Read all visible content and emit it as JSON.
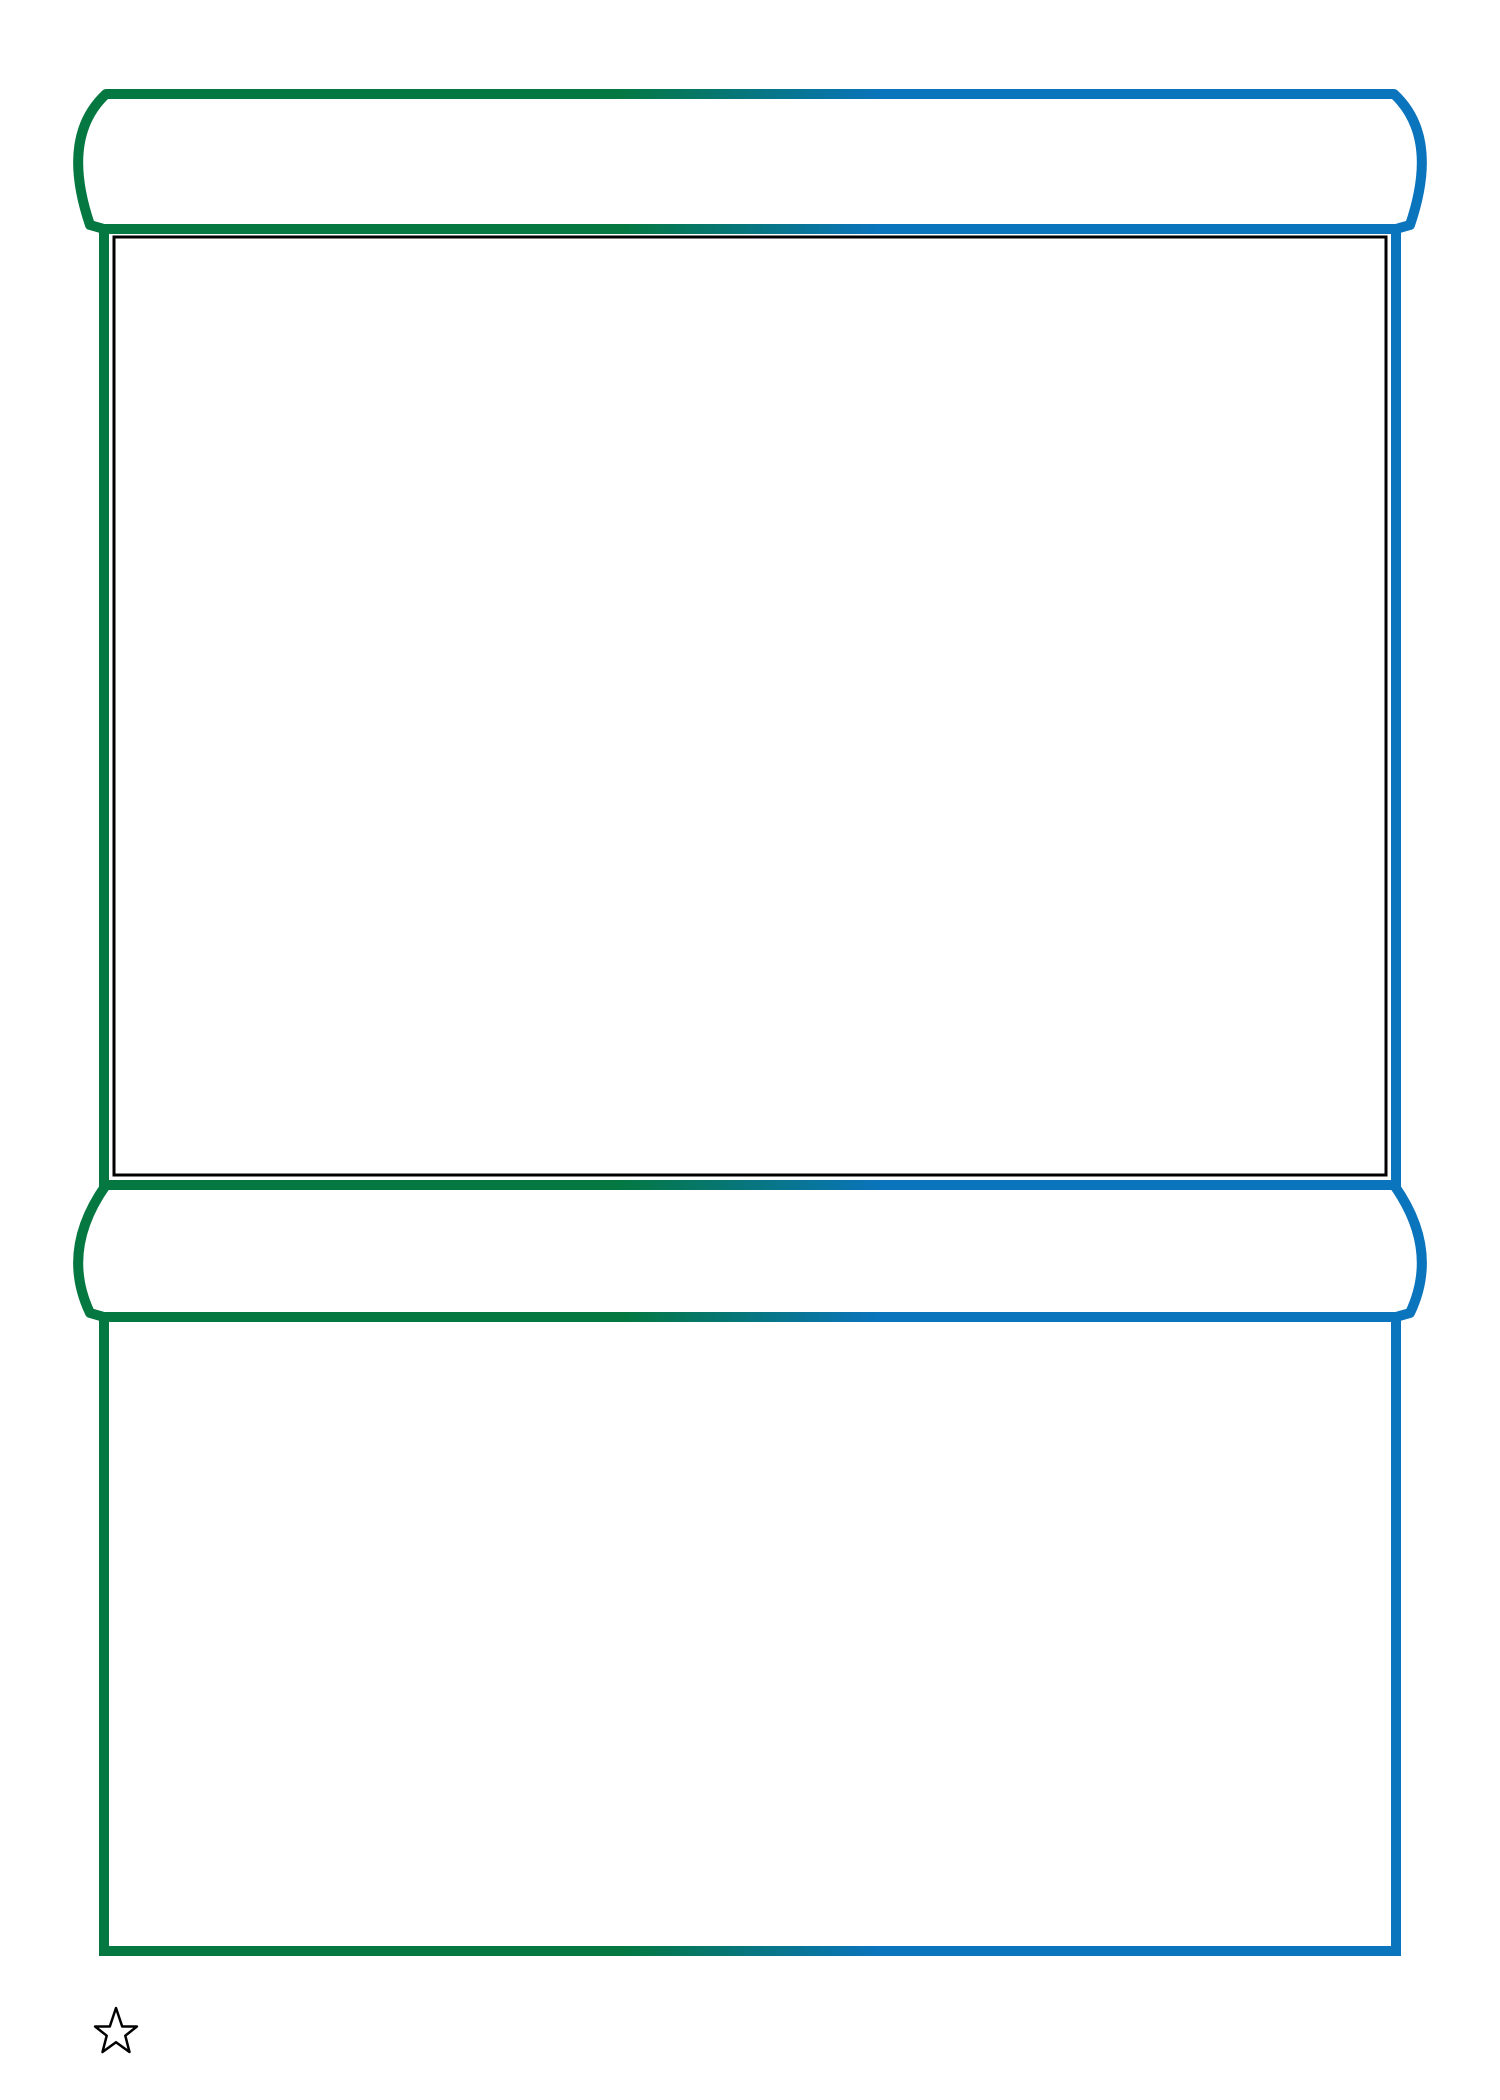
{
  "worksheet": {
    "top_banner": {
      "title": ""
    },
    "bottom_banner": {
      "title": ""
    },
    "footer": {
      "icon": "star-outline-icon"
    }
  },
  "colors": {
    "frame_start": "#047840",
    "frame_end": "#0a74bd",
    "picture_box_border": "#000000",
    "star_outline": "#000000",
    "background": "#ffffff"
  }
}
